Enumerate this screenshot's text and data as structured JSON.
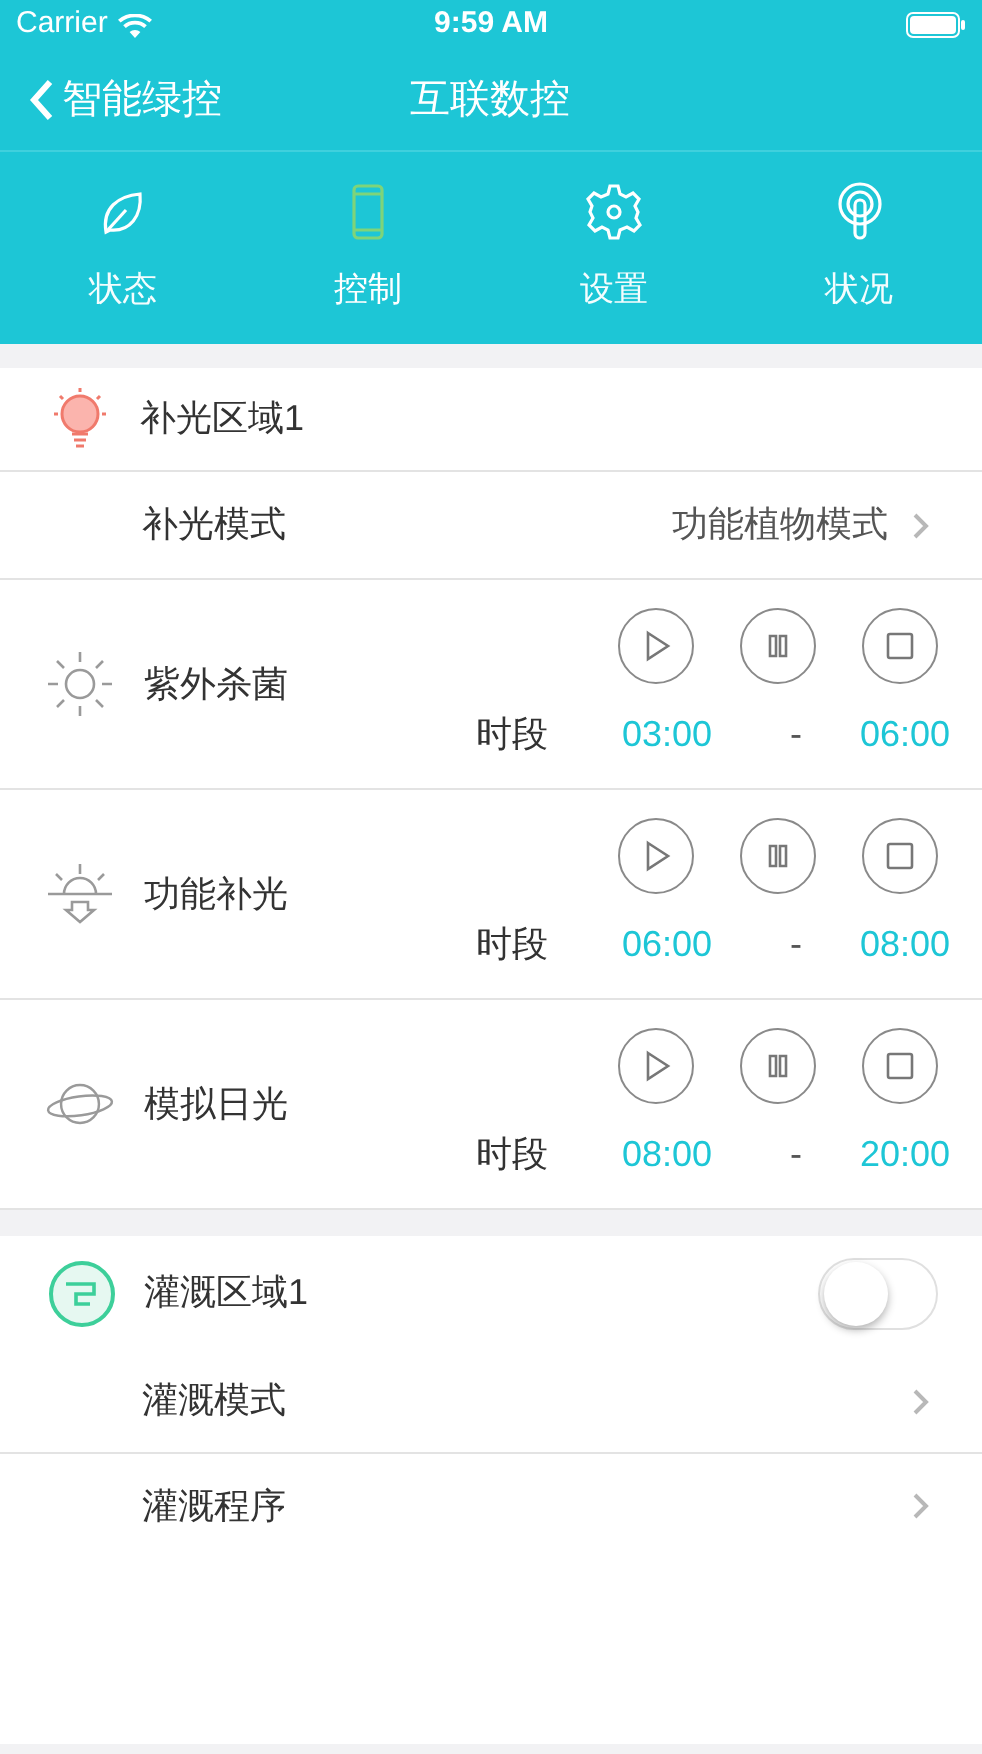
{
  "status_bar": {
    "carrier": "Carrier",
    "time": "9:59 AM"
  },
  "nav": {
    "back": "智能绿控",
    "title": "互联数控"
  },
  "tabs": [
    {
      "label": "状态",
      "kind": "leaf",
      "selected": false
    },
    {
      "label": "控制",
      "kind": "phone",
      "selected": true
    },
    {
      "label": "设置",
      "kind": "gear",
      "selected": false
    },
    {
      "label": "状况",
      "kind": "sensor",
      "selected": false
    }
  ],
  "light_zone": {
    "title": "补光区域1",
    "mode_label": "补光模式",
    "mode_value": "功能植物模式",
    "schedules": [
      {
        "name": "紫外杀菌",
        "kind": "sun",
        "period_label": "时段",
        "start": "03:00",
        "separator": "-",
        "end": "06:00"
      },
      {
        "name": "功能补光",
        "kind": "sunrise",
        "period_label": "时段",
        "start": "06:00",
        "separator": "-",
        "end": "08:00"
      },
      {
        "name": "模拟日光",
        "kind": "planet",
        "period_label": "时段",
        "start": "08:00",
        "separator": "-",
        "end": "20:00"
      }
    ]
  },
  "irrigation_zone": {
    "title": "灌溉区域1",
    "on": false,
    "rows": [
      {
        "label": "灌溉模式"
      },
      {
        "label": "灌溉程序"
      }
    ]
  }
}
